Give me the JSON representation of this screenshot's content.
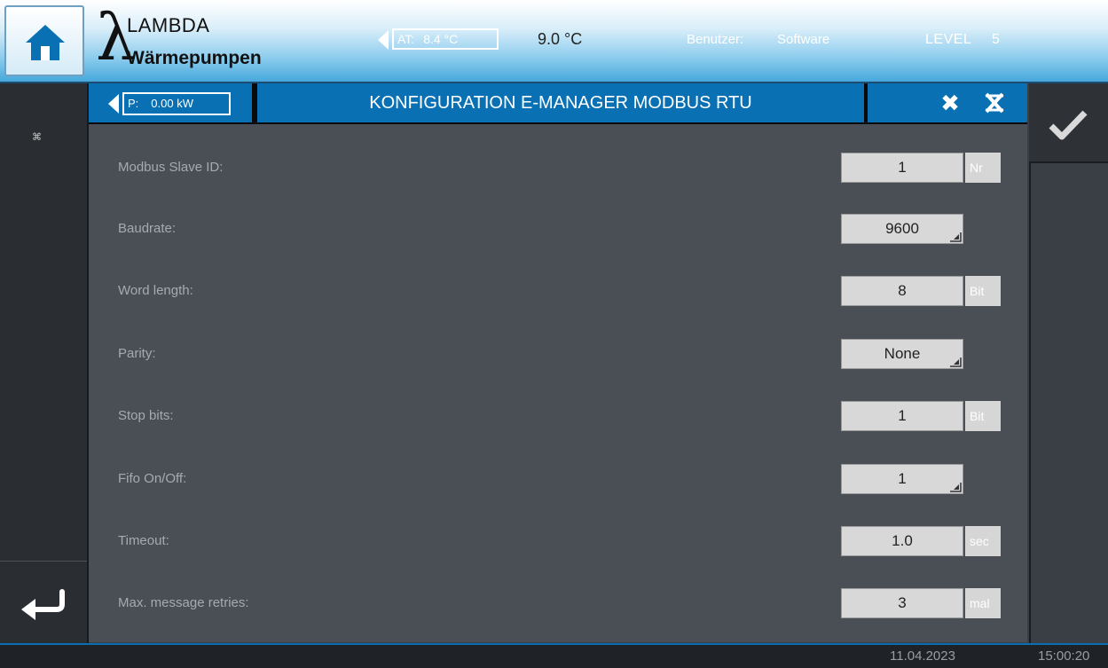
{
  "header": {
    "logo_lambda": "λ",
    "logo_name": "LAMBDA",
    "logo_sub": "Wärmepumpen",
    "at_label": "AT:",
    "at_value": "8.4 °C",
    "temp2": "9.0 °C",
    "user_label": "Benutzer:",
    "user_value": "Software",
    "level_label": "LEVEL",
    "level_value": "5",
    "home_icon": "home-icon"
  },
  "titlebar": {
    "power_label": "P:",
    "power_value": "0.00 kW",
    "title": "KONFIGURATION E-MANAGER MODBUS RTU",
    "close_icon": "close-icon",
    "close_alt_icon": "close-crossed-icon"
  },
  "sidebar": {
    "small_icon": "⌘",
    "back_icon": "return-arrow-icon"
  },
  "right_sidebar": {
    "confirm_icon": "checkmark-icon"
  },
  "settings": [
    {
      "label": "Modbus Slave ID:",
      "value": "1",
      "unit": "Nr",
      "dropdown": false
    },
    {
      "label": "Baudrate:",
      "value": "9600",
      "unit": "",
      "dropdown": true
    },
    {
      "label": "Word length:",
      "value": "8",
      "unit": "Bit",
      "dropdown": false
    },
    {
      "label": "Parity:",
      "value": "None",
      "unit": "",
      "dropdown": true
    },
    {
      "label": "Stop bits:",
      "value": "1",
      "unit": "Bit",
      "dropdown": false
    },
    {
      "label": "Fifo On/Off:",
      "value": "1",
      "unit": "",
      "dropdown": true
    },
    {
      "label": "Timeout:",
      "value": "1.0",
      "unit": "sec",
      "dropdown": false
    },
    {
      "label": "Max. message retries:",
      "value": "3",
      "unit": "mal",
      "dropdown": false
    }
  ],
  "status": {
    "date": "11.04.2023",
    "time": "15:00:20"
  },
  "colors": {
    "header_blue": "#46a8dc",
    "title_blue": "#0a70b4",
    "panel_gray": "#4a4f56",
    "field_gray": "#d8d8d8"
  }
}
